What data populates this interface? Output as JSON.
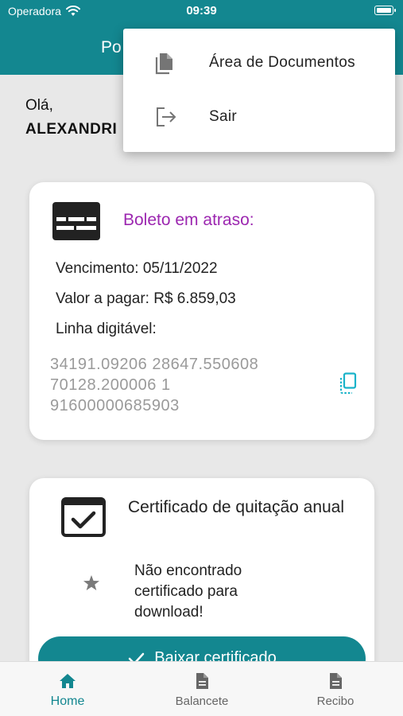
{
  "status_bar": {
    "carrier": "Operadora",
    "time": "09:39"
  },
  "header": {
    "title_partial": "Po"
  },
  "greeting": {
    "hello": "Olá,",
    "user_partial": "ALEXANDRI"
  },
  "boleto_card": {
    "title": "Boleto em atraso:",
    "due_date": "Vencimento: 05/11/2022",
    "amount": "Valor a pagar: R$ 6.859,03",
    "line_label": "Linha digitável:",
    "barcode": "34191.09206  28647.550608\n70128.200006  1\n91600000685903"
  },
  "certificate_card": {
    "title": "Certificado de quitação anual",
    "message": "Não encontrado certificado para download!",
    "download_label": "Baixar certificado"
  },
  "menu": {
    "items": [
      {
        "label": "Área de Documentos",
        "icon": "documents-icon"
      },
      {
        "label": "Sair",
        "icon": "exit-icon"
      }
    ]
  },
  "tabs": [
    {
      "label": "Home",
      "icon": "home-icon",
      "active": true
    },
    {
      "label": "Balancete",
      "icon": "document-icon",
      "active": false
    },
    {
      "label": "Recibo",
      "icon": "document-icon",
      "active": false
    }
  ],
  "colors": {
    "primary": "#138790",
    "accent_purple": "#9c27b0",
    "background": "#e8e8e8",
    "copy_icon": "#1ab3c9"
  }
}
